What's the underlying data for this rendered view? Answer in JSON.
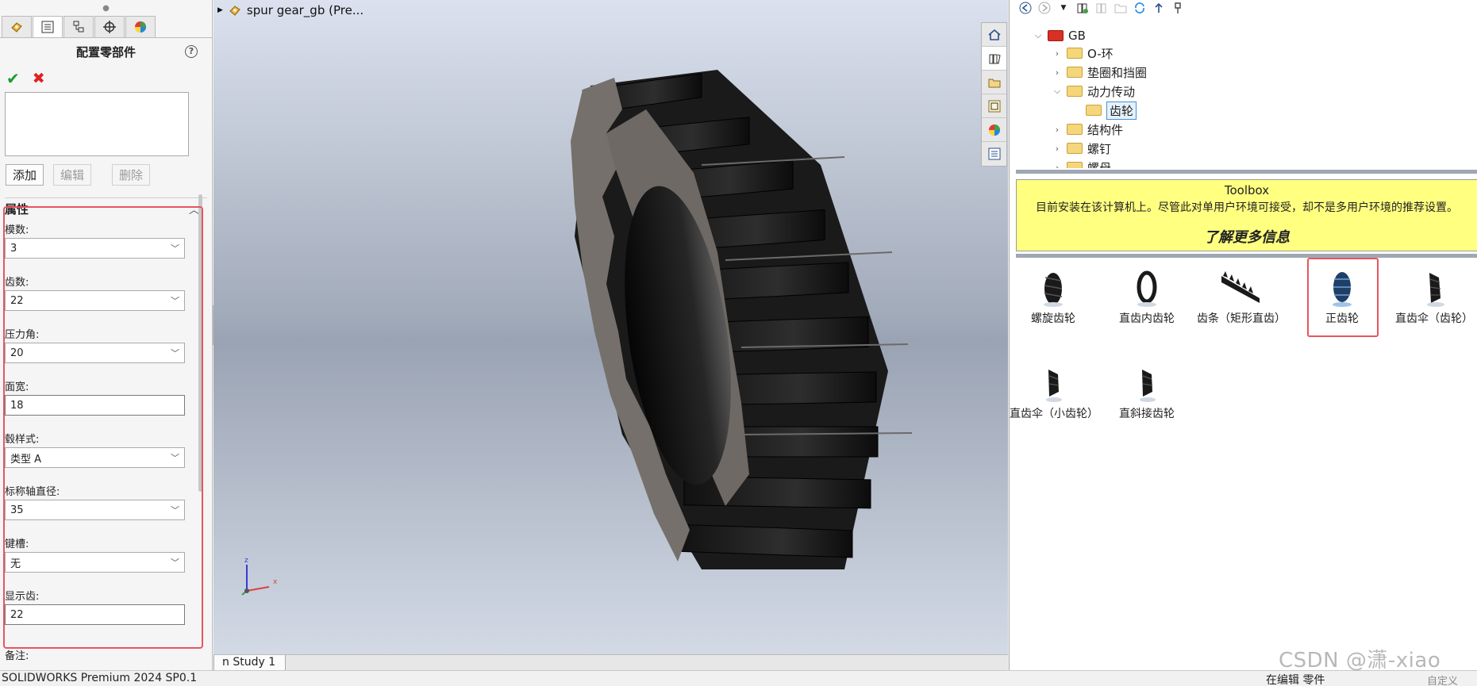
{
  "left_panel": {
    "title": "配置零部件",
    "help": "?",
    "ok": "✔",
    "cancel": "✖",
    "buttons": {
      "add": "添加",
      "edit": "编辑",
      "delete": "删除"
    },
    "properties": {
      "group_title": "属性",
      "fields": [
        {
          "label": "模数:",
          "value": "3",
          "type": "select"
        },
        {
          "label": "齿数:",
          "value": "22",
          "type": "select"
        },
        {
          "label": "压力角:",
          "value": "20",
          "type": "select"
        },
        {
          "label": "面宽:",
          "value": "18",
          "type": "text"
        },
        {
          "label": "毂样式:",
          "value": "类型 A",
          "type": "select"
        },
        {
          "label": "标称轴直径:",
          "value": "35",
          "type": "select"
        },
        {
          "label": "键槽:",
          "value": "无",
          "type": "select"
        },
        {
          "label": "显示齿:",
          "value": "22",
          "type": "text"
        }
      ]
    },
    "notes_label": "备注:"
  },
  "viewport": {
    "document_title": "spur gear_gb (Pre...",
    "triad": {
      "x": "x",
      "z": "z"
    }
  },
  "model_tabs": {
    "active": "n Study 1"
  },
  "status": {
    "app": "SOLIDWORKS Premium 2024 SP0.1",
    "mode": "在编辑 零件",
    "custom": "自定义"
  },
  "watermark": "CSDN @潇-xiao",
  "right_panel": {
    "tree": [
      {
        "label": "GB",
        "level": 0,
        "expanded": true,
        "folder": "gb"
      },
      {
        "label": "O-环",
        "level": 1,
        "expanded": false,
        "folder": "std"
      },
      {
        "label": "垫圈和挡圈",
        "level": 1,
        "expanded": false,
        "folder": "std"
      },
      {
        "label": "动力传动",
        "level": 1,
        "expanded": true,
        "folder": "std"
      },
      {
        "label": "齿轮",
        "level": 2,
        "selected": true,
        "folder": "sel"
      },
      {
        "label": "结构件",
        "level": 1,
        "expanded": false,
        "folder": "std"
      },
      {
        "label": "螺钉",
        "level": 1,
        "expanded": false,
        "folder": "std"
      },
      {
        "label": "螺母",
        "level": 1,
        "expanded": false,
        "folder": "std"
      }
    ],
    "toolbox_note": {
      "title": "Toolbox",
      "text": "目前安装在该计算机上。尽管此对单用户环境可接受，却不是多用户环境的推荐设置。",
      "link": "了解更多信息"
    },
    "items": [
      {
        "label": "螺旋齿轮",
        "icon": "helical-gear-icon"
      },
      {
        "label": "直齿内齿轮",
        "icon": "internal-gear-icon"
      },
      {
        "label": "齿条（矩形直齿）",
        "icon": "rack-icon"
      },
      {
        "label": "正齿轮",
        "icon": "spur-gear-icon",
        "highlighted": true
      },
      {
        "label": "直齿伞（齿轮）",
        "icon": "bevel-gear-icon"
      },
      {
        "label": "直齿伞（小齿轮）",
        "icon": "bevel-pinion-icon"
      },
      {
        "label": "直斜接齿轮",
        "icon": "miter-gear-icon"
      }
    ]
  },
  "colors": {
    "accent_red": "#e8555f",
    "note_yellow": "#ffff80",
    "ok_green": "#1b9c2c"
  }
}
